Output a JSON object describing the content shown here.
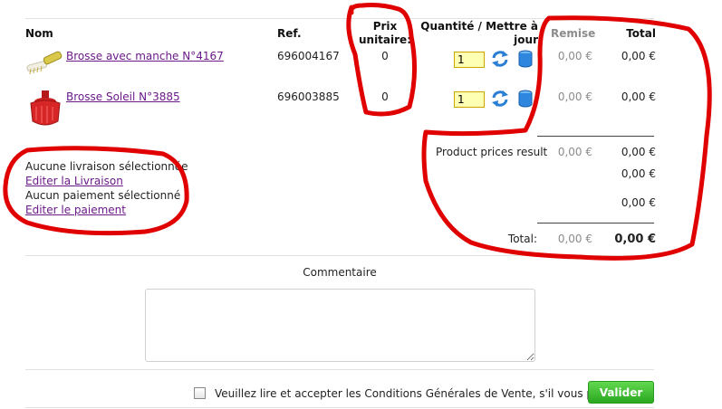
{
  "headers": {
    "name": "Nom",
    "ref": "Ref.",
    "unit_price_line1": "Prix",
    "unit_price_line2": "unitaire:",
    "quantity_line1": "Quantité / Mettre à",
    "quantity_line2": "jour",
    "discount": "Remise",
    "total": "Total"
  },
  "items": [
    {
      "name": "Brosse avec manche N°4167",
      "ref": "696004167",
      "unit_price": "0",
      "quantity": "1",
      "discount": "0,00 €",
      "total": "0,00 €"
    },
    {
      "name": "Brosse Soleil N°3885",
      "ref": "696003885",
      "unit_price": "0",
      "quantity": "1",
      "discount": "0,00 €",
      "total": "0,00 €"
    }
  ],
  "summary": {
    "product_prices_label": "Product prices result",
    "product_prices_discount": "0,00 €",
    "product_prices_total": "0,00 €",
    "line2_total": "0,00 €",
    "line3_total": "0,00 €",
    "total_label": "Total:",
    "total_discount": "0,00 €",
    "grand_total": "0,00 €"
  },
  "delivery": {
    "no_delivery": "Aucune livraison sélectionnée",
    "edit_delivery": "Editer la Livraison",
    "no_payment": "Aucun paiement sélectionné",
    "edit_payment": "Editer le paiement"
  },
  "comment": {
    "label": "Commentaire",
    "value": ""
  },
  "footer": {
    "terms_label": "Veuillez lire et accepter les Conditions Générales de Vente, s'il vous plaît.",
    "submit_label": "Valider"
  },
  "colors": {
    "annotation": "#e00000",
    "button_green": "#3cbf2c",
    "qty_bg": "#ffffb3",
    "link": "#6b1a8a"
  }
}
